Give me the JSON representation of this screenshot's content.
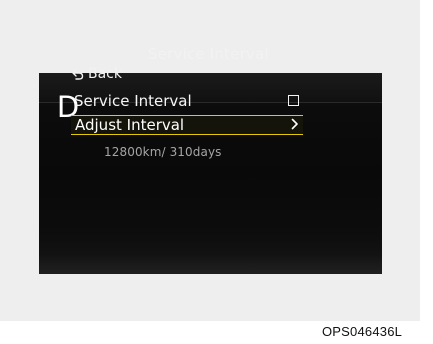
{
  "screen": {
    "gear": "D",
    "title": "Service Interval",
    "back_label": "Back",
    "items": [
      {
        "label": "Service Interval",
        "checked": false
      },
      {
        "label": "Adjust Interval",
        "selected": true,
        "indicator": ">"
      }
    ],
    "interval_value": "12800km/ 310days",
    "colors": {
      "selection_border": "#e5ca00",
      "text": "#f2f2f2",
      "secondary_text": "#a5a5a5",
      "background": "#0a0a0a"
    }
  },
  "caption": "OPS046436L"
}
